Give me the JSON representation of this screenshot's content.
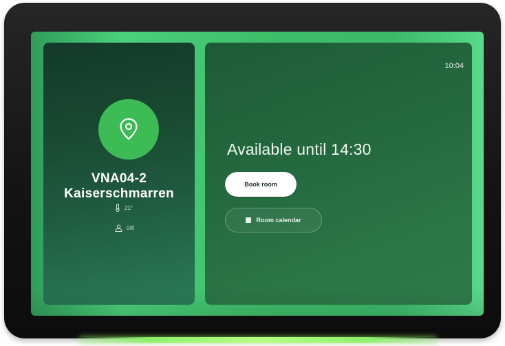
{
  "room": {
    "name_line1": "VNA04-2",
    "name_line2": "Kaiserschmarren",
    "location_icon": "map-pin-icon",
    "temperature": "21°",
    "temperature_icon": "thermometer-icon",
    "capacity": "0/8",
    "capacity_icon": "people-icon"
  },
  "status": {
    "time": "10:04",
    "availability": "Available until 14:30"
  },
  "actions": {
    "book_label": "Book room",
    "calendar_label": "Room calendar",
    "calendar_icon": "calendar-icon"
  },
  "colors": {
    "accent_green": "#3dbb55",
    "screen_glow": "#4bd07b",
    "panel_dark": "#13392a",
    "led_bar": "#8ef06a"
  }
}
